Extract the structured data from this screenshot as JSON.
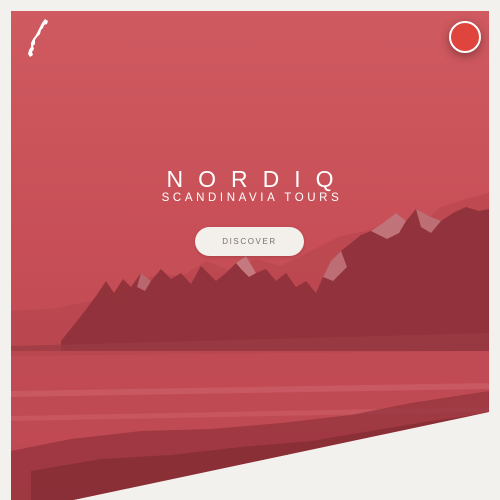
{
  "brand": {
    "title": "NORDIQ",
    "subtitle": "SCANDINAVIA TOURS"
  },
  "hero": {
    "cta_label": "DISCOVER",
    "overlay_color": "#c84f57"
  },
  "header": {
    "logo_icon": "norway-map-icon",
    "menu_icon": "menu-dot-icon",
    "menu_color": "#e0453d"
  },
  "colors": {
    "page_background": "#f2f1ee",
    "button_background": "#f3efea",
    "text_light": "#ffffff"
  }
}
